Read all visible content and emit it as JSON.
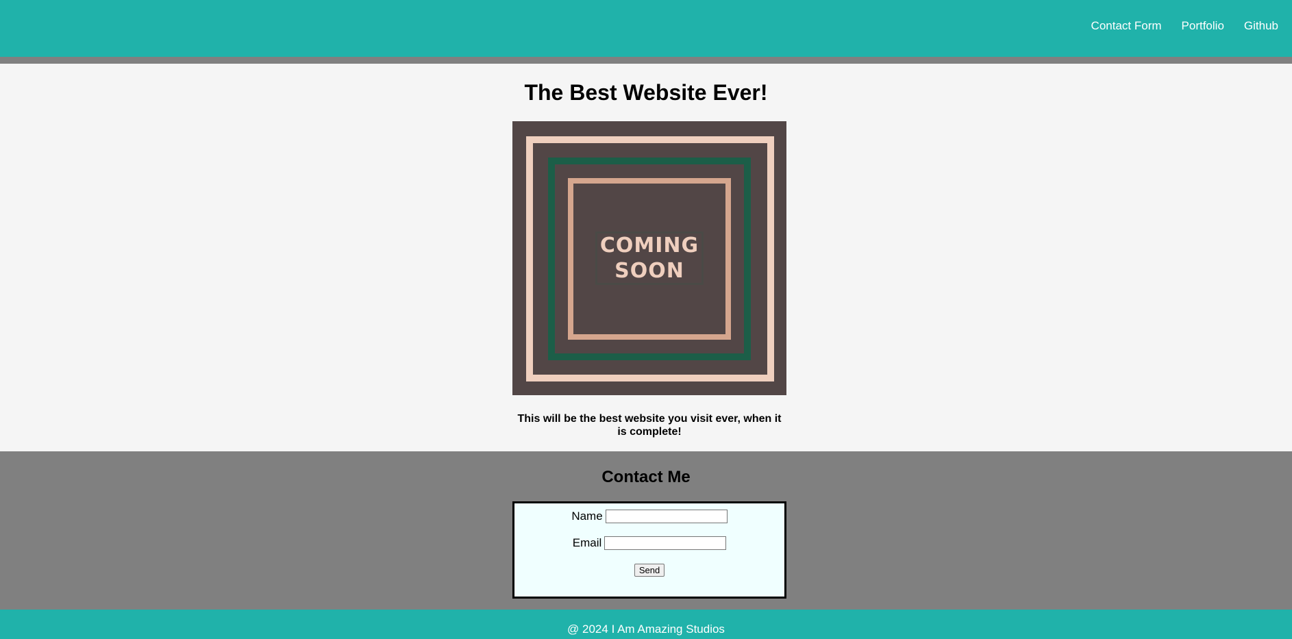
{
  "nav": {
    "items": [
      {
        "label": "Contact Form"
      },
      {
        "label": "Portfolio"
      },
      {
        "label": "Github"
      }
    ]
  },
  "main": {
    "title": "The Best Website Ever!",
    "image_text_line1": "COMING",
    "image_text_line2": "SOON",
    "tagline": "This will be the best website you visit ever, when it is complete!"
  },
  "contact": {
    "title": "Contact Me",
    "name_label": "Name",
    "name_value": "",
    "email_label": "Email",
    "email_value": "",
    "send_label": "Send"
  },
  "footer": {
    "text": "@ 2024 I Am Amazing Studios"
  },
  "colors": {
    "header": "#20b2aa",
    "divider": "#808080",
    "main_bg": "#f5f5f5",
    "contact_bg": "#808080",
    "form_bg": "#f0ffff",
    "image_bg": "#524646",
    "frame_outer": "#efcfbe",
    "frame_middle": "#1c5e48",
    "frame_inner": "#d5a68e"
  }
}
